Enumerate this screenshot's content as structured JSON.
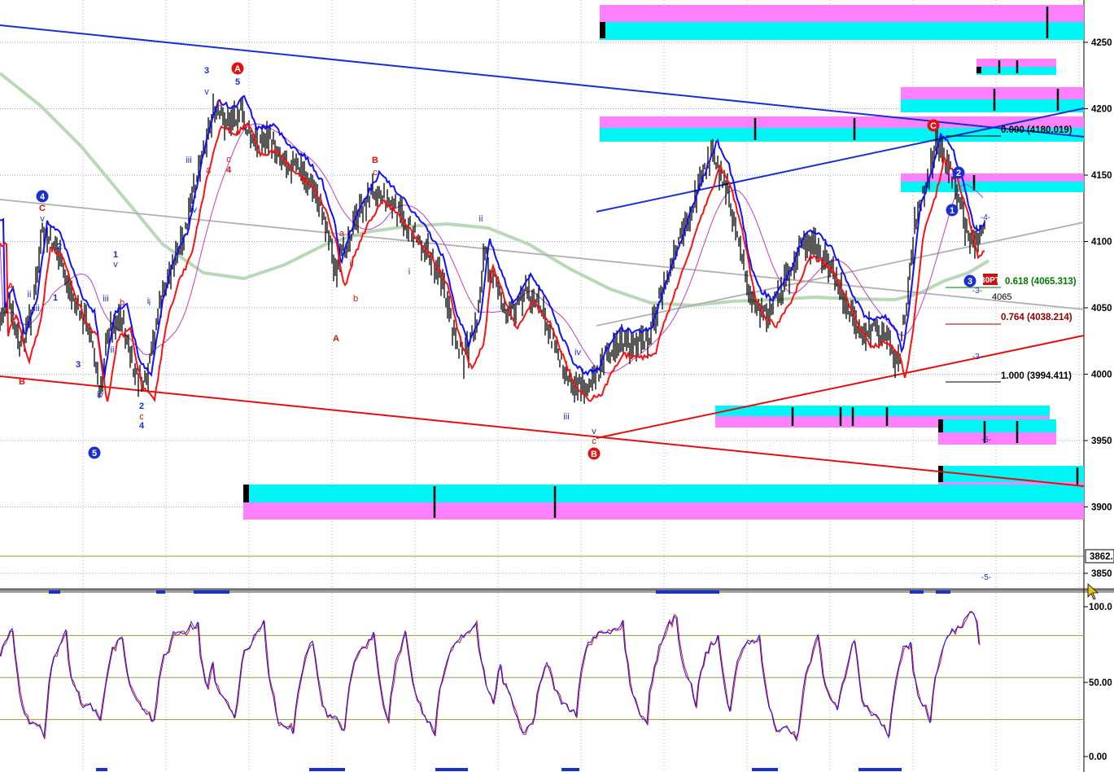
{
  "chart_data": [
    {
      "type": "line",
      "panel": "price",
      "title": "",
      "ylim": [
        3825,
        4275
      ],
      "yticks": [
        4250,
        4200,
        4150,
        4100,
        4050,
        4000,
        3950,
        3900,
        3850
      ],
      "price_marker": "3862.",
      "grid": true,
      "colors": {
        "bull_zone": "#00f5f5",
        "bear_zone": "#ff80ff",
        "upper_band": "#1010ff",
        "lower_band": "#ff1010",
        "ma": "#b8d8b8",
        "trend_blue": "#1a2fd0",
        "trend_red": "#e01010",
        "trend_gray": "#b0b0b0"
      },
      "fib_labels": [
        {
          "text": "0.000 (4180.019)",
          "price": 4180.019,
          "color": "#000000"
        },
        {
          "text": "0.618 (4065.313)",
          "price": 4065.313,
          "color": "#007a00"
        },
        {
          "text": "0.764 (4038.214)",
          "price": 4038.214,
          "color": "#8b0000"
        },
        {
          "text": "1.000 (3994.411)",
          "price": 3994.411,
          "color": "#000000"
        }
      ],
      "misc_labels": {
        "level_4065": "4065",
        "pt_badge": "30PT",
        "wave_3dash": "-3-",
        "wave_4dash": "-4-",
        "wave_5dash": "-5-"
      },
      "wave_circles": [
        {
          "label": "A",
          "color": "#e01010"
        },
        {
          "label": "B",
          "color": "#e01010"
        },
        {
          "label": "C",
          "color": "#e01010"
        },
        {
          "label": "4",
          "color": "#1a2fd0"
        },
        {
          "label": "5",
          "color": "#1a2fd0"
        },
        {
          "label": "1",
          "color": "#1a2fd0"
        },
        {
          "label": "2",
          "color": "#1a2fd0"
        },
        {
          "label": "3",
          "color": "#1a2fd0"
        }
      ],
      "wave_labels": [
        "A",
        "B",
        "ii",
        "iii",
        "1",
        "2",
        "3",
        "v",
        "C",
        "4",
        "iv",
        "i",
        "iii",
        "1",
        "v",
        "ii",
        "b",
        "c",
        "2",
        "iii",
        "i",
        "3",
        "v",
        "5",
        "b",
        "a",
        "c",
        "4",
        "ii",
        "iv",
        "B",
        "c",
        "a",
        "A",
        "b",
        "ii",
        "i",
        "i",
        "iv",
        "iii",
        "v",
        "c"
      ]
    },
    {
      "type": "line",
      "panel": "oscillator",
      "ylim": [
        0,
        100
      ],
      "yticks": [
        "100.0",
        "50.00",
        "0.00"
      ],
      "levels": [
        80,
        50,
        20
      ],
      "series": [
        {
          "color": "#1010ff"
        },
        {
          "color": "#e01010"
        }
      ]
    }
  ]
}
